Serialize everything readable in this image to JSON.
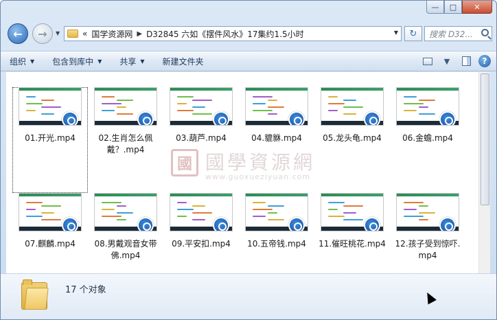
{
  "window": {
    "caption_minimize": "—",
    "caption_maximize": "□",
    "caption_close": "✕"
  },
  "nav": {
    "back_glyph": "←",
    "forward_glyph": "→",
    "dropdown_glyph": "▼"
  },
  "address": {
    "overflow": "«",
    "crumbs": [
      "国学资源网",
      "D32845 六如《摆件风水》17集约1.5小时"
    ],
    "separator": "▶",
    "dropdown_glyph": "▼"
  },
  "refresh_glyph": "↻",
  "search": {
    "placeholder": "搜索 D32..."
  },
  "command_bar": {
    "organize": "组织",
    "include_library": "包含到库中",
    "share": "共享",
    "new_folder": "新建文件夹",
    "arrow": "▼"
  },
  "help_glyph": "?",
  "files": [
    {
      "name": "01.开光.mp4"
    },
    {
      "name": "02.生肖怎么佩戴？.mp4"
    },
    {
      "name": "03.葫芦.mp4"
    },
    {
      "name": "04.貔貅.mp4"
    },
    {
      "name": "05.龙头龟.mp4"
    },
    {
      "name": "06.金蟾.mp4"
    },
    {
      "name": "07.麒麟.mp4"
    },
    {
      "name": "08.男戴观音女带佛.mp4"
    },
    {
      "name": "09.平安扣.mp4"
    },
    {
      "name": "10.五帝钱.mp4"
    },
    {
      "name": "11.催旺桃花.mp4"
    },
    {
      "name": "12.孩子受到惊吓.mp4"
    }
  ],
  "watermark": {
    "logo_char": "國",
    "text": "國學資源網",
    "url": "www.guoxueziyuan.com"
  },
  "status": {
    "count": "17 个对象"
  },
  "icons": {
    "vlc": "vlc-media-icon",
    "folder": "folder-icon",
    "search": "search-icon",
    "cursor": "mouse-cursor-icon"
  }
}
